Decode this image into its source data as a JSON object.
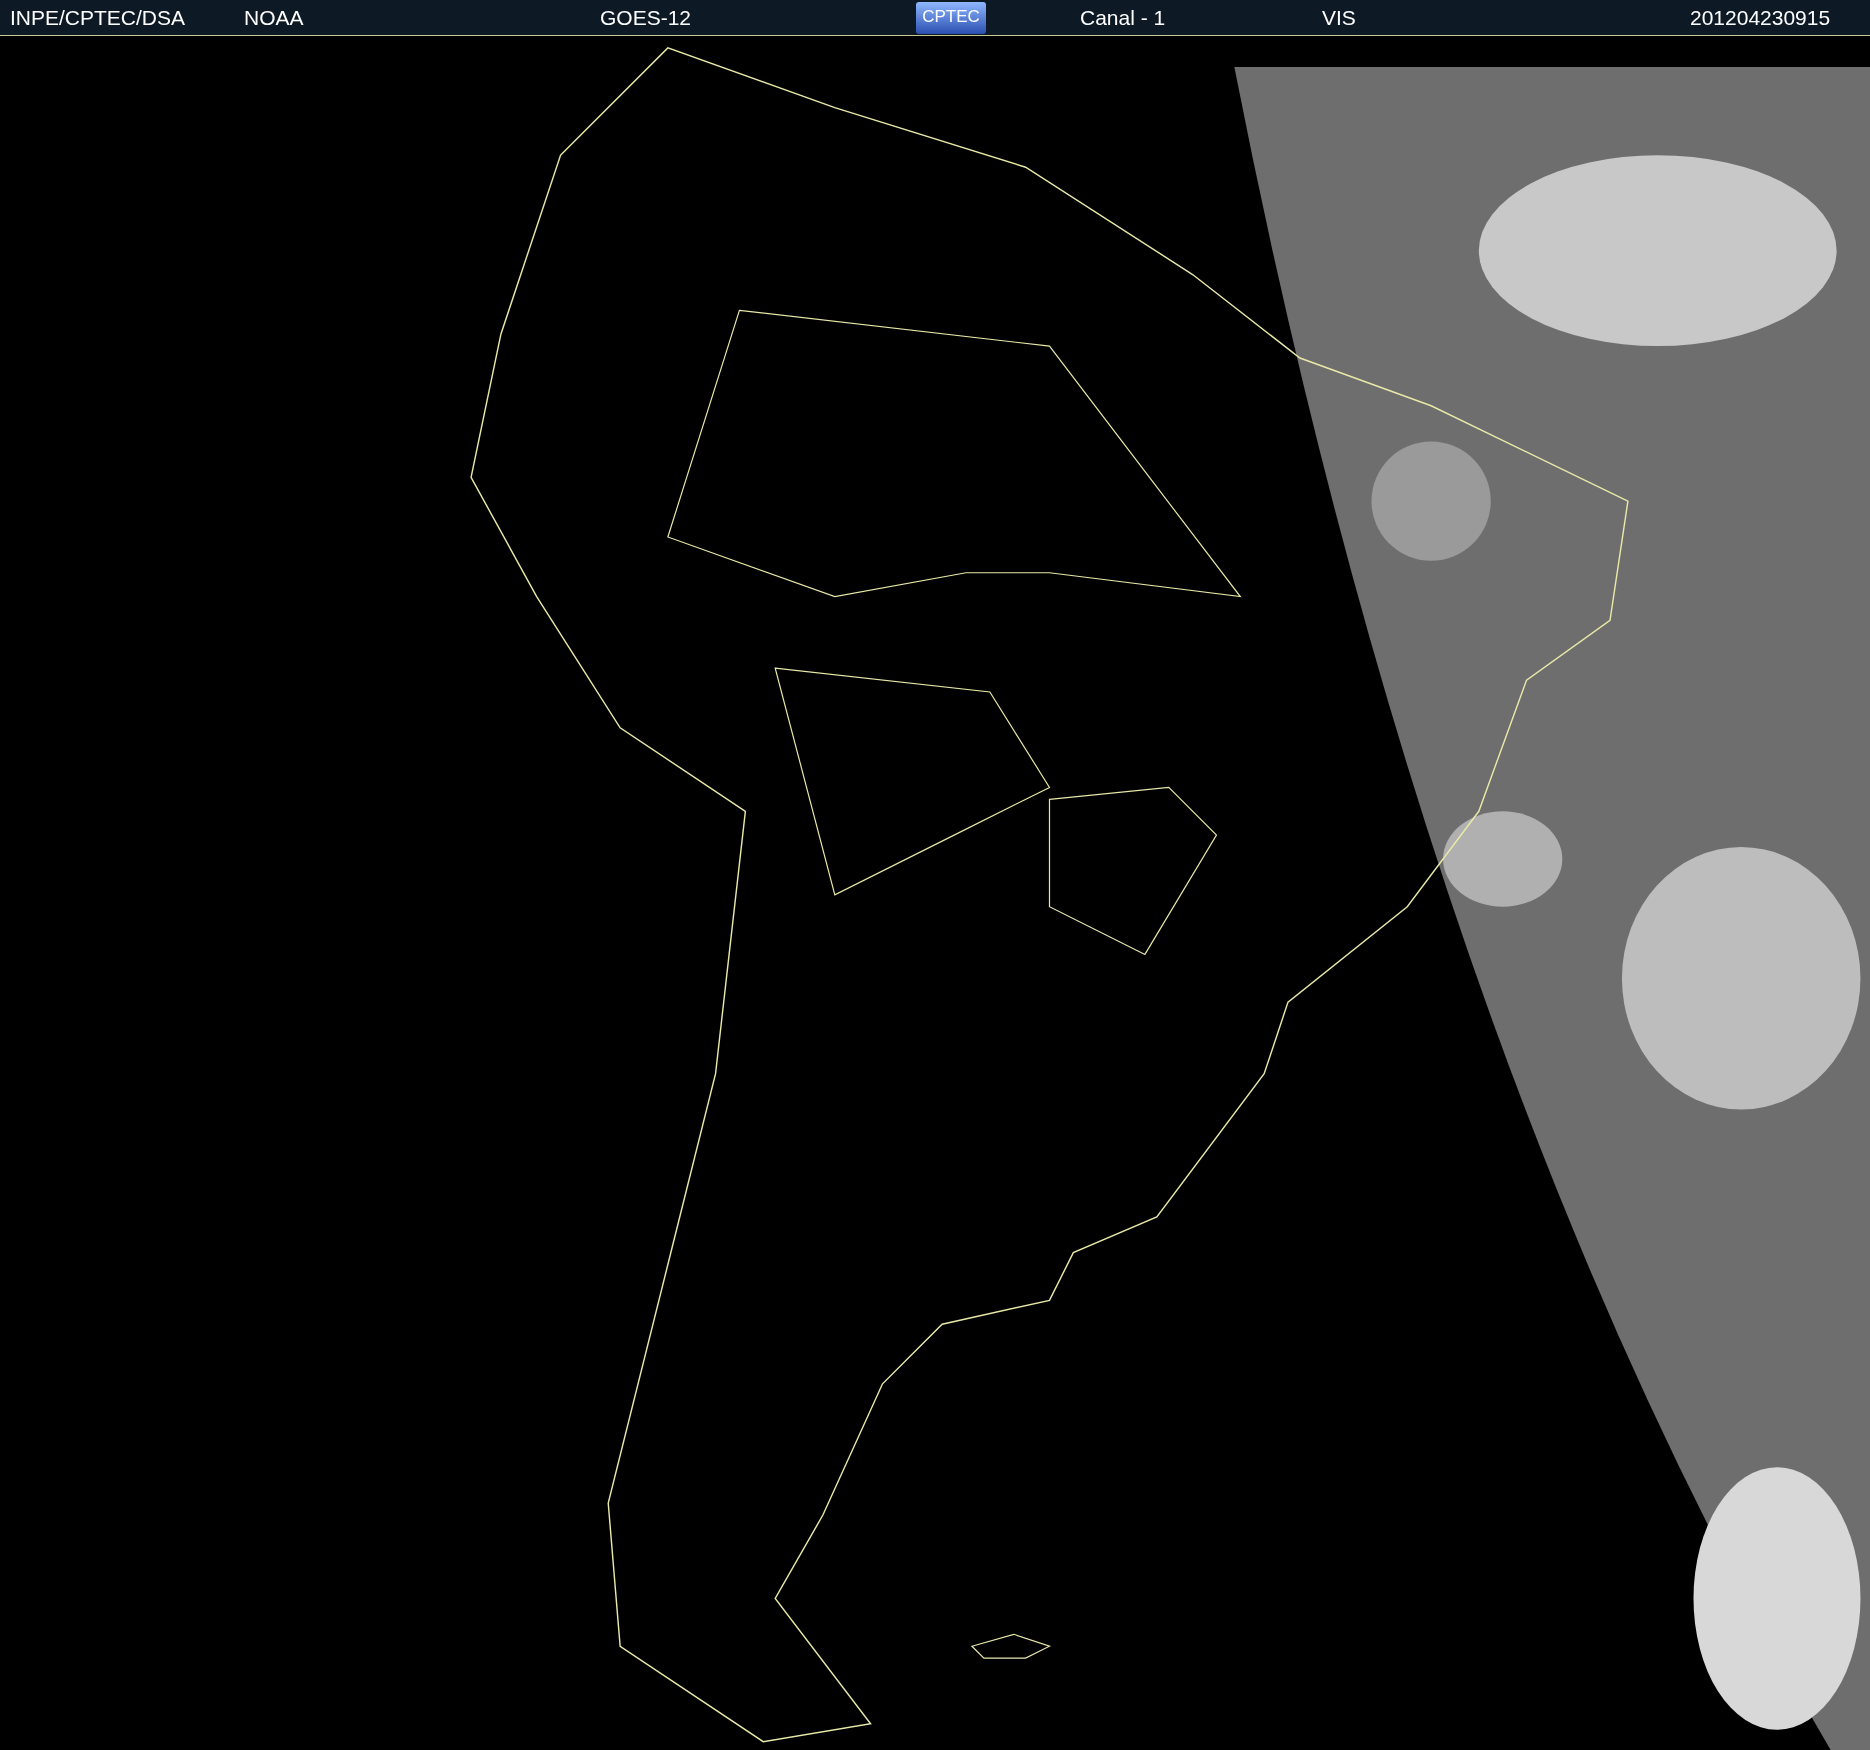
{
  "header": [
    {
      "kind": "text",
      "text": "INPE/CPTEC/DSA"
    },
    {
      "kind": "text",
      "text": "NOAA"
    },
    {
      "kind": "text",
      "text": "GOES-12"
    },
    {
      "kind": "logo",
      "text": "CPTEC"
    },
    {
      "kind": "text",
      "text": "Canal - 1"
    },
    {
      "kind": "text",
      "text": "VIS"
    },
    {
      "kind": "text",
      "text": "201204230915"
    }
  ]
}
